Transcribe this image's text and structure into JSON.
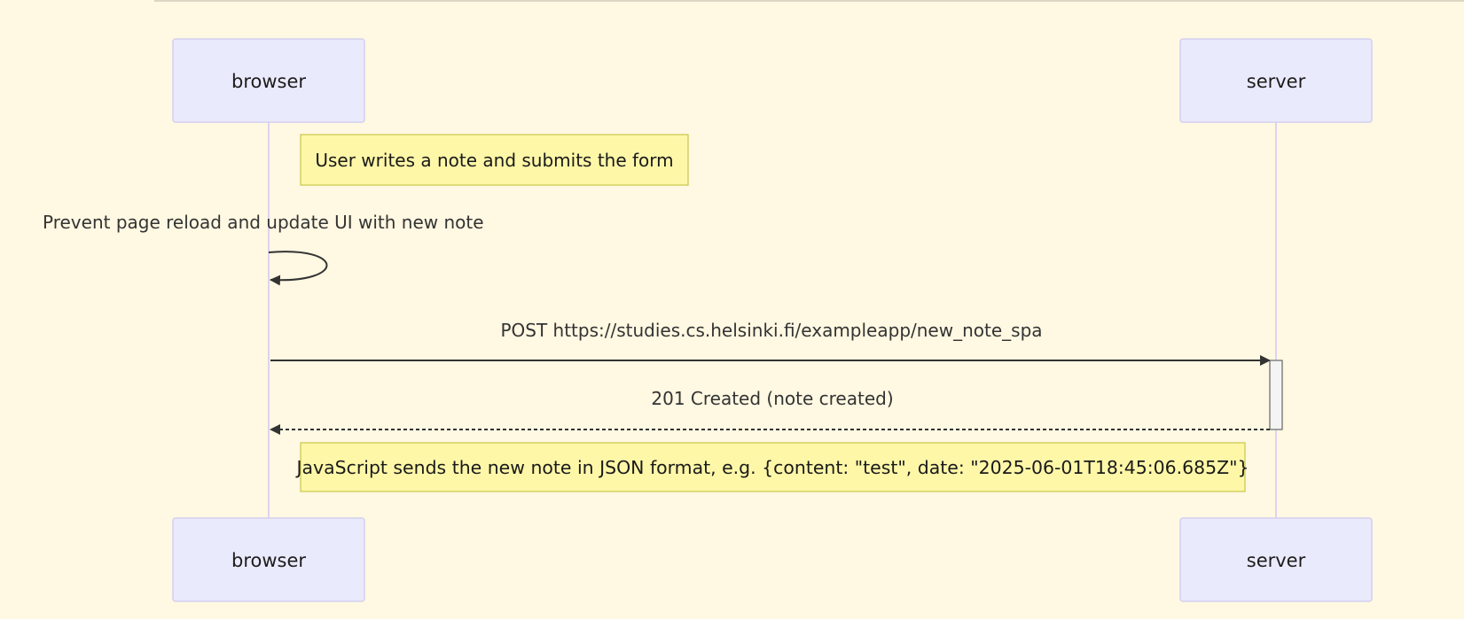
{
  "diagram": {
    "type": "sequence",
    "participants": [
      {
        "id": "browser",
        "label": "browser"
      },
      {
        "id": "server",
        "label": "server"
      }
    ],
    "notes": [
      {
        "text": "User writes a note and submits the form"
      },
      {
        "text": "JavaScript sends the new note in JSON format, e.g. {content: \"test\", date: \"2025-06-01T18:45:06.685Z\"}"
      }
    ],
    "messages": [
      {
        "from": "browser",
        "to": "browser",
        "style": "solid",
        "text": "Prevent page reload and update UI with new note"
      },
      {
        "from": "browser",
        "to": "server",
        "style": "solid",
        "text": "POST https://studies.cs.helsinki.fi/exampleapp/new_note_spa"
      },
      {
        "from": "server",
        "to": "browser",
        "style": "dashed",
        "text": "201 Created (note created)"
      }
    ]
  },
  "colors": {
    "background": "#fff8e2",
    "actor_fill": "#eaeafd",
    "actor_border": "#d3d0f0",
    "note_fill": "#fef7a8",
    "note_border": "#c9c64b",
    "lifeline": "#ddd3f0",
    "arrow": "#333333"
  }
}
